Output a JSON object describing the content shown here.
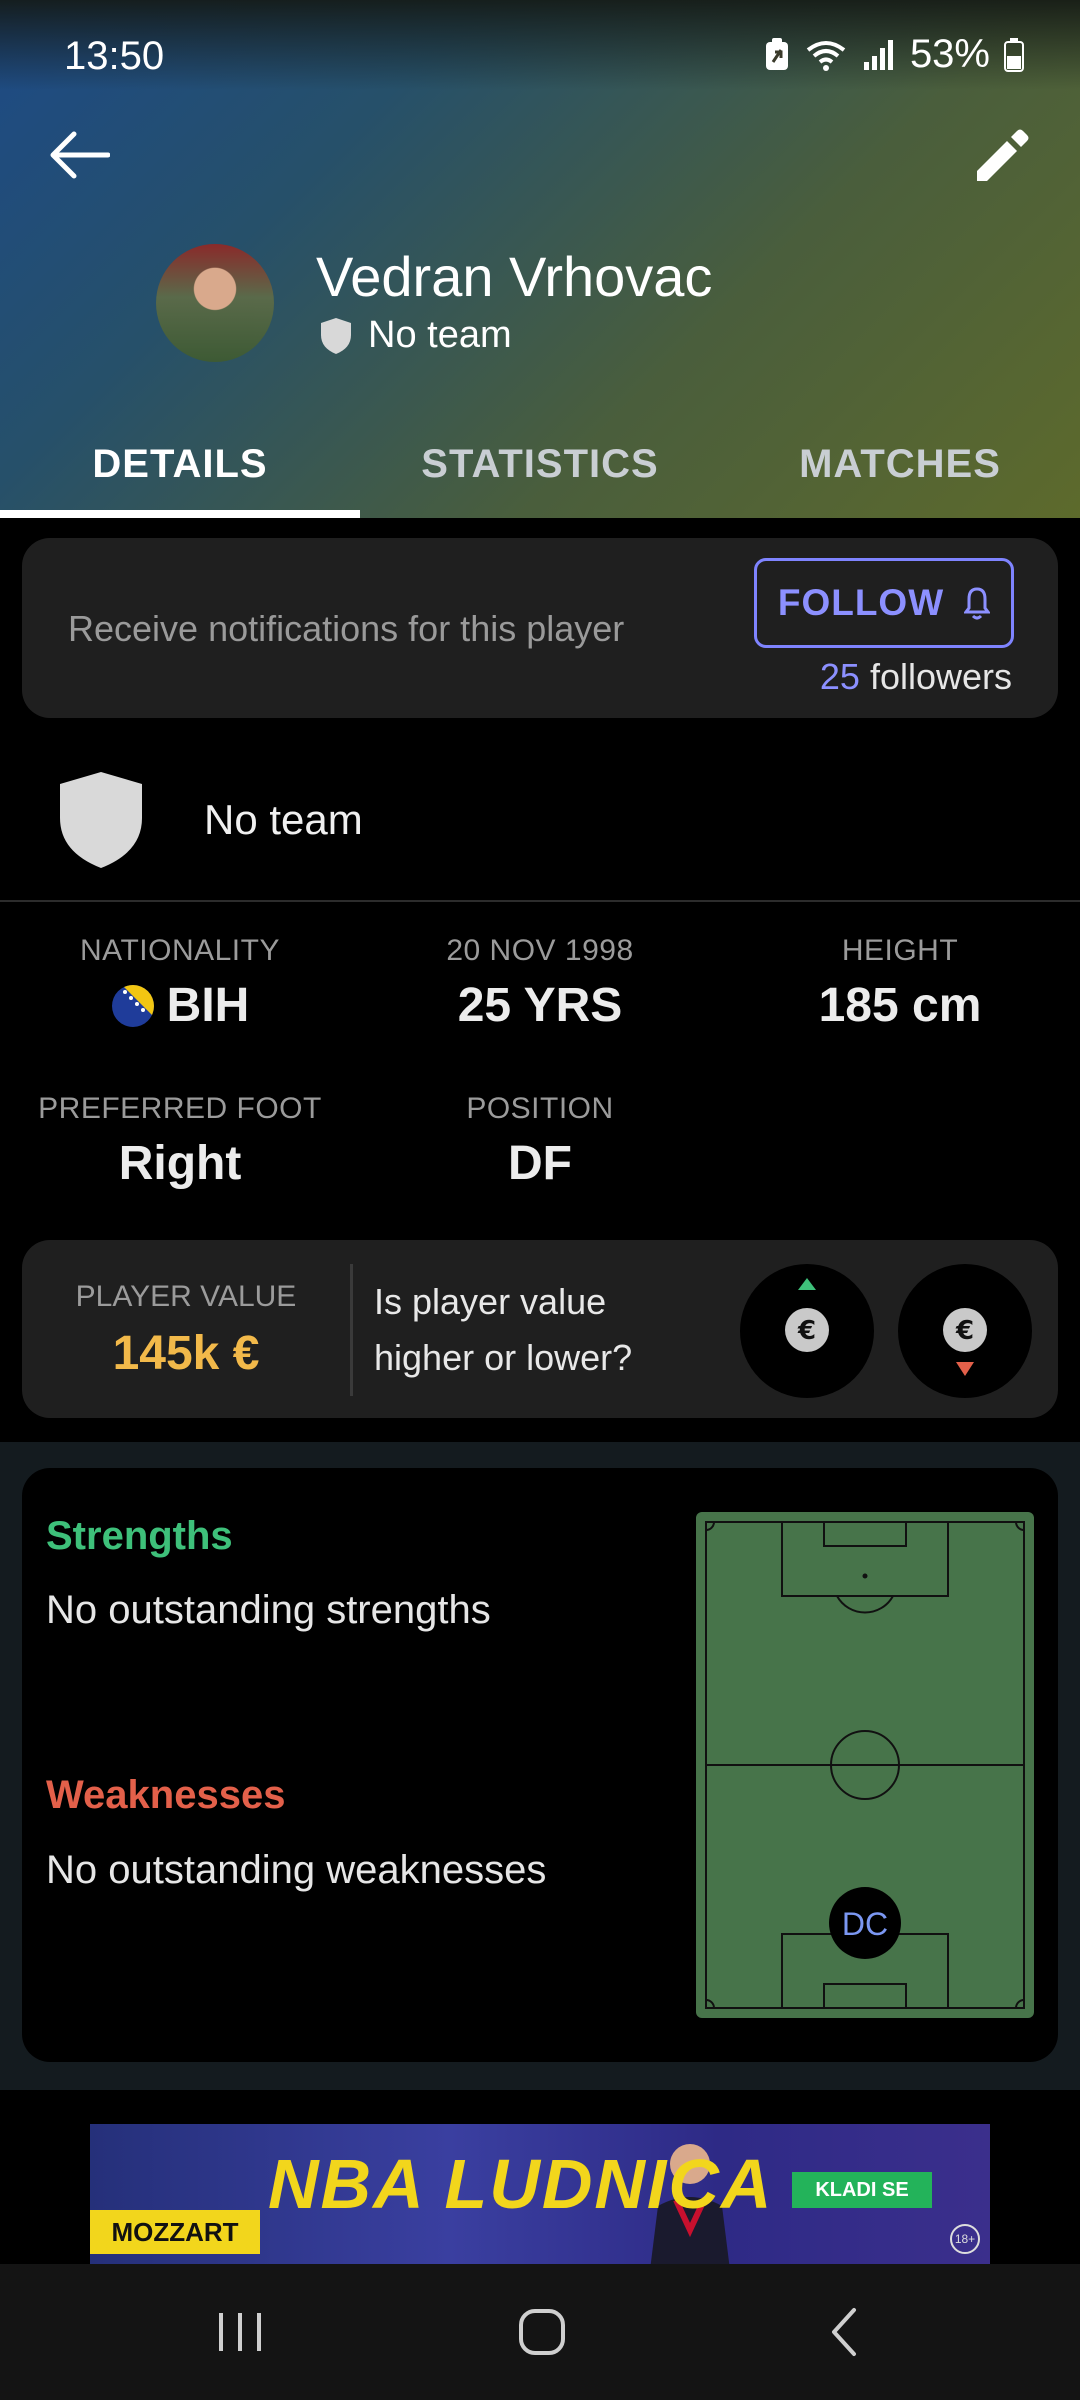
{
  "status": {
    "time": "13:50",
    "battery": "53%"
  },
  "header": {
    "player_name": "Vedran Vrhovac",
    "team": "No team"
  },
  "tabs": [
    {
      "label": "DETAILS",
      "active": true
    },
    {
      "label": "STATISTICS",
      "active": false
    },
    {
      "label": "MATCHES",
      "active": false
    }
  ],
  "follow": {
    "text": "Receive notifications for this player",
    "button_label": "FOLLOW",
    "followers_count": "25",
    "followers_label": "followers"
  },
  "team_row": {
    "label": "No team"
  },
  "info": {
    "nationality_label": "NATIONALITY",
    "nationality_value": "BIH",
    "dob_label": "20 NOV 1998",
    "age_value": "25 YRS",
    "height_label": "HEIGHT",
    "height_value": "185 cm",
    "foot_label": "PREFERRED FOOT",
    "foot_value": "Right",
    "position_label": "POSITION",
    "position_value": "DF"
  },
  "player_value": {
    "label": "PLAYER VALUE",
    "value": "145k €",
    "question": "Is player value higher or lower?"
  },
  "strengths": {
    "title": "Strengths",
    "text": "No outstanding strengths"
  },
  "weaknesses": {
    "title": "Weaknesses",
    "text": "No outstanding weaknesses"
  },
  "pitch": {
    "position_marker": "DC"
  },
  "ad": {
    "brand": "MOZZART",
    "headline": "NBA LUDNICA",
    "cta": "KLADI SE",
    "age": "18+"
  },
  "colors": {
    "accent": "#8c90ff",
    "value": "#f2b94a",
    "strengths": "#3ec07a",
    "weaknesses": "#e3604a",
    "pitch": "#47744a"
  }
}
